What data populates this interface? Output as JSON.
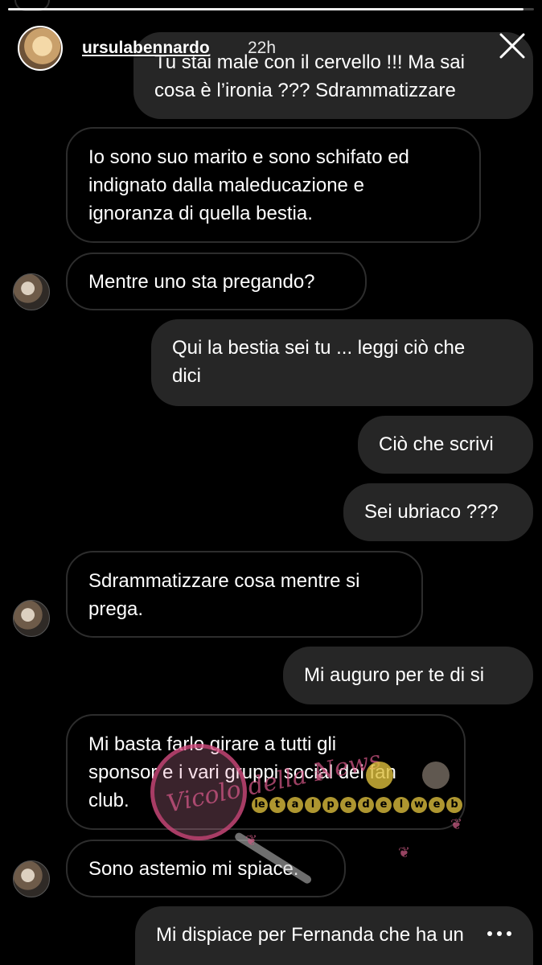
{
  "story": {
    "username": "ursulabennardo",
    "time": "22h",
    "progress": 0.98
  },
  "messages": [
    {
      "side": "out",
      "lines": [
        "Tu stai male con il cervello !!! Ma sai",
        "cosa è l’ironia ??? Sdrammatizzare"
      ]
    },
    {
      "side": "in",
      "lines": [
        "Io sono suo marito e sono schifato ed",
        "indignato dalla maleducazione e",
        "ignoranza di quella bestia."
      ]
    },
    {
      "side": "in",
      "lines": [
        "Mentre uno sta pregando?"
      ]
    },
    {
      "side": "out",
      "lines": [
        "Qui la bestia sei tu ... leggi ciò che",
        "dici"
      ]
    },
    {
      "side": "out",
      "lines": [
        "Ciò che scrivi"
      ]
    },
    {
      "side": "out",
      "lines": [
        "Sei ubriaco ???"
      ]
    },
    {
      "side": "in",
      "lines": [
        "Sdrammatizzare cosa mentre si",
        "prega."
      ]
    },
    {
      "side": "out",
      "lines": [
        "Mi auguro per te di si"
      ]
    },
    {
      "side": "in",
      "lines": [
        "Mi basta farlo girare a tutti gli",
        "sponsor e i vari gruppi social dei fan",
        "club."
      ]
    },
    {
      "side": "in",
      "lines": [
        "Sono astemio mi spiace."
      ]
    },
    {
      "side": "out",
      "lines": [
        "Mi dispiace per Fernanda che ha un"
      ]
    }
  ],
  "watermark": {
    "script_text": "Vicolo della News",
    "banner_letters": [
      "le",
      "t",
      "a",
      "l",
      "p",
      "e",
      "d",
      "e",
      "l",
      "w",
      "e",
      "b"
    ]
  }
}
